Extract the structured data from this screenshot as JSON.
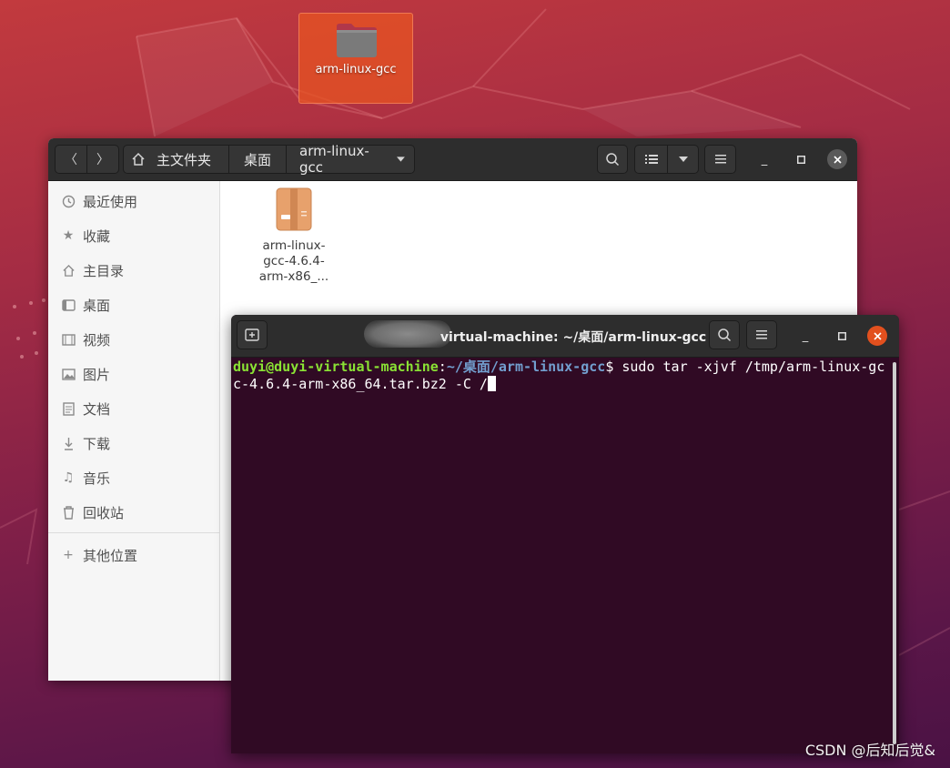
{
  "desktop": {
    "icon_label": "arm-linux-gcc"
  },
  "file_manager": {
    "path": [
      "主文件夹",
      "桌面",
      "arm-linux-gcc"
    ],
    "sidebar": {
      "items": [
        {
          "label": "最近使用",
          "icon": "clock-icon"
        },
        {
          "label": "收藏",
          "icon": "star-icon"
        },
        {
          "label": "主目录",
          "icon": "home-icon"
        },
        {
          "label": "桌面",
          "icon": "desktop-icon"
        },
        {
          "label": "视频",
          "icon": "video-icon"
        },
        {
          "label": "图片",
          "icon": "picture-icon"
        },
        {
          "label": "文档",
          "icon": "document-icon"
        },
        {
          "label": "下载",
          "icon": "download-icon"
        },
        {
          "label": "音乐",
          "icon": "music-icon"
        },
        {
          "label": "回收站",
          "icon": "trash-icon"
        }
      ],
      "other_locations": "其他位置"
    },
    "files": [
      {
        "name_lines": [
          "arm-linux-",
          "gcc-4.6.4-",
          "arm-x86_..."
        ],
        "icon": "archive-icon"
      }
    ]
  },
  "terminal": {
    "title": "virtual-machine: ~/桌面/arm-linux-gcc",
    "prompt_user": "duyi@duyi-virtual-machine",
    "prompt_sep": ":",
    "prompt_path": "~/桌面/arm-linux-gcc",
    "prompt_symbol": "$ ",
    "command_line1": "sudo tar -xjvf /tmp/arm-linux-gc",
    "command_line2": "c-4.6.4-arm-x86_64.tar.bz2 -C /"
  },
  "watermark": "CSDN @后知后觉&",
  "colors": {
    "accent": "#e95420",
    "terminal_bg": "#300a24",
    "prompt_user": "#8ae234",
    "prompt_path": "#729fcf"
  }
}
